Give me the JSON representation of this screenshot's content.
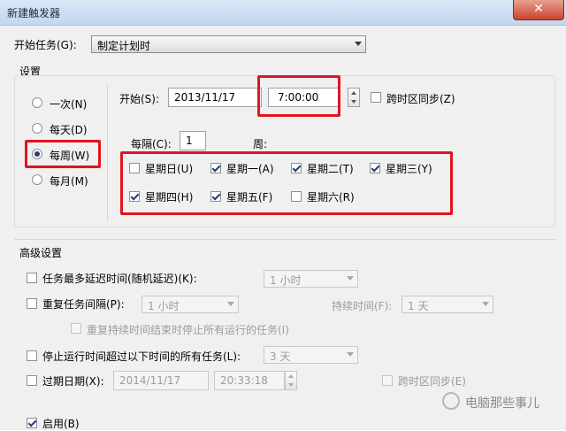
{
  "window": {
    "title": "新建触发器",
    "close_glyph": "✕"
  },
  "begin_task": {
    "label": "开始任务(G):",
    "value": "制定计划时"
  },
  "settings": {
    "legend": "设置",
    "frequency_options": [
      {
        "label": "一次(N)",
        "selected": false
      },
      {
        "label": "每天(D)",
        "selected": false
      },
      {
        "label": "每周(W)",
        "selected": true
      },
      {
        "label": "每月(M)",
        "selected": false
      }
    ],
    "start_label": "开始(S):",
    "start_date": "2013/11/17",
    "start_time": "7:00:00",
    "sync_timezone_label": "跨时区同步(Z)",
    "sync_timezone_checked": false,
    "recur_label": "每隔(C):",
    "recur_value": "1",
    "recur_unit": "周:",
    "weekdays": [
      {
        "label": "星期日(U)",
        "checked": false
      },
      {
        "label": "星期一(A)",
        "checked": true
      },
      {
        "label": "星期二(T)",
        "checked": true
      },
      {
        "label": "星期三(Y)",
        "checked": true
      },
      {
        "label": "星期四(H)",
        "checked": true
      },
      {
        "label": "星期五(F)",
        "checked": true
      },
      {
        "label": "星期六(R)",
        "checked": false
      }
    ]
  },
  "advanced": {
    "legend": "高级设置",
    "delay": {
      "label": "任务最多延迟时间(随机延迟)(K):",
      "value": "1 小时",
      "checked": false
    },
    "repeat": {
      "label": "重复任务间隔(P):",
      "value": "1 小时",
      "checked": false,
      "duration_label": "持续时间(F):",
      "duration_value": "1 天"
    },
    "stop_running": {
      "label": "重复持续时间结束时停止所有运行的任务(I)",
      "checked": false
    },
    "stop_longer": {
      "label": "停止运行时间超过以下时间的所有任务(L):",
      "value": "3 天",
      "checked": false
    },
    "expire": {
      "label": "过期日期(X):",
      "date": "2014/11/17",
      "time": "20:33:18",
      "checked": false,
      "sync_label": "跨时区同步(E)",
      "sync_checked": false
    },
    "enabled": {
      "label": "启用(B)",
      "checked": true
    }
  },
  "watermark": {
    "text": "电脑那些事儿"
  }
}
